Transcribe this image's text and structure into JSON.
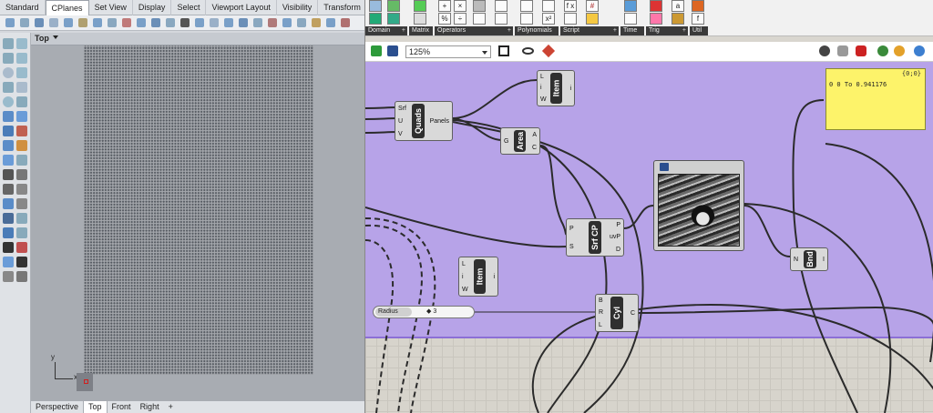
{
  "rhino": {
    "tabs": [
      "Standard",
      "CPlanes",
      "Set View",
      "Display",
      "Select",
      "Viewport Layout",
      "Visibility",
      "Transform"
    ],
    "active_tab": "CPlanes",
    "viewport_title": "Top",
    "axis_labels": {
      "x": "x",
      "y": "y"
    },
    "viewport_tabs": [
      "Perspective",
      "Top",
      "Front",
      "Right",
      "+"
    ],
    "active_viewport_tab": "Top"
  },
  "grasshopper": {
    "ribbon_groups": [
      "Domain",
      "Matrix",
      "Operators",
      "Polynomials",
      "Script",
      "Time",
      "Trig",
      "Util"
    ],
    "ribbon_glyphs": [
      "+",
      "×",
      "%",
      "÷",
      "f x",
      "x²",
      "#",
      "a",
      "f"
    ],
    "zoom": "125%",
    "components": {
      "quads": {
        "title": "Quads",
        "inputs": [
          "Srf",
          "U",
          "V"
        ],
        "outputs": [
          "Panels"
        ]
      },
      "item_top": {
        "title": "Item",
        "inputs": [
          "L",
          "i",
          "W"
        ],
        "outputs": [
          "i"
        ]
      },
      "area": {
        "title": "Area",
        "inputs": [
          "G"
        ],
        "outputs": [
          "A",
          "C"
        ]
      },
      "srf_cp": {
        "title": "Srf CP",
        "inputs": [
          "P",
          "S"
        ],
        "outputs": [
          "P",
          "uvP",
          "D"
        ]
      },
      "item_bottom": {
        "title": "Item",
        "inputs": [
          "L",
          "i",
          "W"
        ],
        "outputs": [
          "i"
        ]
      },
      "cyl": {
        "title": "Cyl",
        "inputs": [
          "B",
          "R",
          "L"
        ],
        "outputs": [
          "C"
        ]
      },
      "bnd": {
        "title": "Bnd",
        "inputs": [
          "N"
        ],
        "outputs": [
          "I"
        ]
      }
    },
    "slider": {
      "name": "Radius",
      "value": "◆ 3"
    },
    "panel": {
      "header": "{0;0}",
      "text": "0 0 To 0.941176"
    },
    "colors": {
      "group": "#b7a3e8",
      "panel": "#fdf36a",
      "component_core": "#2f2f2f"
    }
  }
}
